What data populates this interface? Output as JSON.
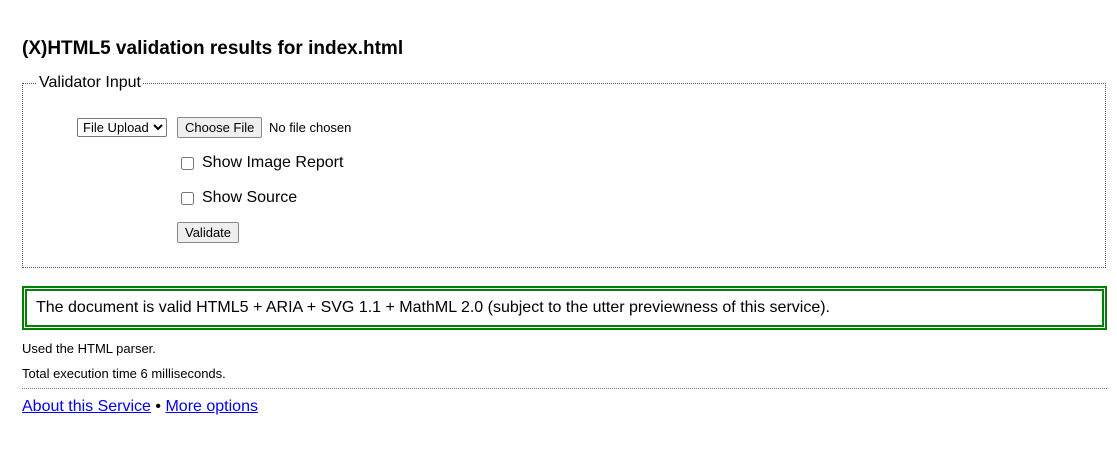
{
  "page": {
    "title": "(X)HTML5 validation results for index.html"
  },
  "input": {
    "legend": "Validator Input",
    "mode_select": "File Upload",
    "choose_file": "Choose File",
    "file_status": "No file chosen",
    "show_image_report": "Show Image Report",
    "show_source": "Show Source",
    "validate": "Validate"
  },
  "result": {
    "message": "The document is valid HTML5 + ARIA + SVG 1.1 + MathML 2.0 (subject to the utter previewness of this service).",
    "parser": "Used the HTML parser.",
    "time": "Total execution time 6 milliseconds.",
    "border_color": "#008000"
  },
  "footer": {
    "about": "About this Service",
    "separator": "•",
    "more": "More options"
  }
}
